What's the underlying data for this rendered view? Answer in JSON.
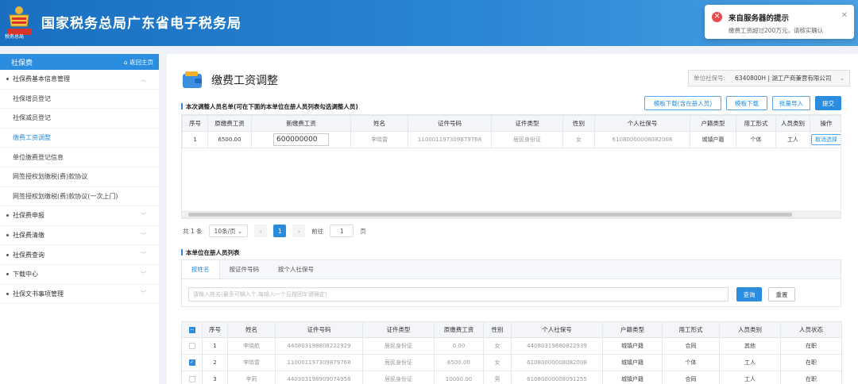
{
  "header": {
    "title": "国家税务总局广东省电子税务局",
    "emblem_text": "税务总局"
  },
  "toast": {
    "title": "来自服务器的提示",
    "message": "缴费工资超过200万元，请核实确认"
  },
  "sidebar": {
    "title": "社保费",
    "home_link": "返回主页",
    "items": [
      {
        "label": "社保费基本信息管理",
        "type": "group"
      },
      {
        "label": "社保增员登记",
        "type": "sub"
      },
      {
        "label": "社保减员登记",
        "type": "sub"
      },
      {
        "label": "缴费工资调整",
        "type": "sub"
      },
      {
        "label": "单位缴费登记信息",
        "type": "sub"
      },
      {
        "label": "网签授权划缴税(费)款协议",
        "type": "sub"
      },
      {
        "label": "网签授权划缴税(费)款协议(一次上门)",
        "type": "sub"
      },
      {
        "label": "社保费申报",
        "type": "group"
      },
      {
        "label": "社保费清缴",
        "type": "group"
      },
      {
        "label": "社保费查询",
        "type": "group"
      },
      {
        "label": "下载中心",
        "type": "group"
      },
      {
        "label": "社保文书事项管理",
        "type": "group"
      }
    ]
  },
  "main": {
    "title": "缴费工资调整",
    "unit_label": "单位社保号:",
    "unit_value": "6340800H | 湖工产商兼营有限公司",
    "section1_title": "本次调整人员名单(可在下面的本单位在册人员列表勾选调整人员)",
    "buttons": {
      "template_registered": "模板下载(含在册人员)",
      "template": "模板下载",
      "batch_import": "批量导入",
      "submit": "提交"
    },
    "adjust_table": {
      "headers": [
        "序号",
        "原缴费工资",
        "新缴费工资",
        "姓名",
        "证件号码",
        "证件类型",
        "性别",
        "个人社保号",
        "户籍类型",
        "用工形式",
        "人员类别",
        "操作"
      ],
      "rows": [
        {
          "no": "1",
          "old_wage": "6500.00",
          "new_wage": "600000000",
          "name": "李晓雷",
          "id_no": "110001197309879768",
          "id_type": "居民身份证",
          "gender": "女",
          "ss_no": "61080000008082008",
          "household": "城镇户籍",
          "employment": "个体",
          "category": "工人",
          "action": "取消选择"
        }
      ]
    },
    "pager": {
      "total": "共 1 条",
      "page_size": "10条/页",
      "prev": "‹",
      "current": "1",
      "next": "›",
      "goto": "前往",
      "goto_value": "1",
      "page_unit": "页"
    },
    "section2_title": "本单位在册人员列表",
    "tabs": [
      "按姓名",
      "按证件号码",
      "按个人社保号"
    ],
    "search_placeholder": "请输入姓名(最多可输入个,每输入一个后按回车键确定)",
    "query_button": "查询",
    "reset_button": "重置",
    "roster_table": {
      "headers": [
        "",
        "序号",
        "姓名",
        "证件号码",
        "证件类型",
        "原缴费工资",
        "性别",
        "个人社保号",
        "户籍类型",
        "用工形式",
        "人员类别",
        "人员状态"
      ],
      "rows": [
        {
          "checked": false,
          "no": "1",
          "name": "李晓航",
          "id_no": "440803198808222929",
          "id_type": "居民身份证",
          "wage": "0.00",
          "gender": "女",
          "ss_no": "44080319880822939",
          "household": "城镇户籍",
          "employment": "合同",
          "category": "其他",
          "status": "在职"
        },
        {
          "checked": true,
          "no": "2",
          "name": "李晓雷",
          "id_no": "110001197309879768",
          "id_type": "居民身份证",
          "wage": "6500.00",
          "gender": "女",
          "ss_no": "61080000008082008",
          "household": "城镇户籍",
          "employment": "个体",
          "category": "工人",
          "status": "在职"
        },
        {
          "checked": false,
          "no": "3",
          "name": "李莉",
          "id_no": "440303198909074958",
          "id_type": "居民身份证",
          "wage": "10000.00",
          "gender": "男",
          "ss_no": "61080000008091255",
          "household": "城镇户籍",
          "employment": "合同",
          "category": "工人",
          "status": "在职"
        }
      ]
    }
  }
}
